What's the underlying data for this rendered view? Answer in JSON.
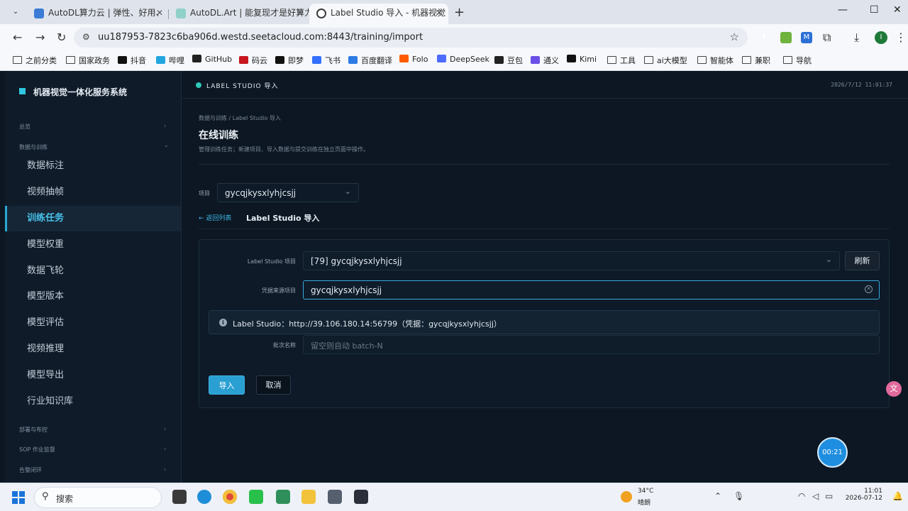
{
  "browser": {
    "tabs": [
      {
        "title": "AutoDL算力云 | 弹性、好用、",
        "favicon_color": "#3a7bd5"
      },
      {
        "title": "AutoDL.Art | 能复现才是好算力",
        "favicon_color": "#8fd0c8"
      },
      {
        "title": "Label Studio 导入 - 机器视觉",
        "favicon_color": "#3a3a3a"
      }
    ],
    "new_tab": "+",
    "url": "uu187953-7823c6ba906d.westd.seetacloud.com:8443/training/import",
    "profile_initial": "I",
    "extensions": [
      {
        "label": "⬇",
        "color": "#3b3b3b"
      },
      {
        "label": "●",
        "color": "#6fb33c"
      },
      {
        "label": "M",
        "color": "#2c6fd6"
      }
    ],
    "bookmarks": [
      {
        "label": "之前分类",
        "icon": "folder"
      },
      {
        "label": "国家政务",
        "icon": "folder"
      },
      {
        "label": "抖音",
        "icon": "#111111"
      },
      {
        "label": "哔哩",
        "icon": "#21a6e0"
      },
      {
        "label": "GitHub",
        "icon": "#222222"
      },
      {
        "label": "码云",
        "icon": "#c7161e"
      },
      {
        "label": "即梦",
        "icon": "#111111"
      },
      {
        "label": "飞书",
        "icon": "#3370ff"
      },
      {
        "label": "百度翻译",
        "icon": "#2d7be5"
      },
      {
        "label": "Folo",
        "icon": "#ff5c00"
      },
      {
        "label": "DeepSeek",
        "icon": "#4d6bfe"
      },
      {
        "label": "豆包",
        "icon": "#222222"
      },
      {
        "label": "通义",
        "icon": "#6a4ee8"
      },
      {
        "label": "Kimi",
        "icon": "#111111"
      },
      {
        "label": "工具",
        "icon": "folder"
      },
      {
        "label": "ai大模型",
        "icon": "folder"
      },
      {
        "label": "智能体",
        "icon": "folder"
      },
      {
        "label": "兼职",
        "icon": "folder"
      },
      {
        "label": "导航",
        "icon": "folder"
      }
    ]
  },
  "app": {
    "system_title": "机器视觉一体化服务系统",
    "header_title": "LABEL STUDIO 导入",
    "header_time": "2026/7/12 11:01:37",
    "sidebar": {
      "groups": [
        {
          "label": "总览",
          "chevron": "›"
        },
        {
          "label": "数据与训练",
          "chevron": "⌄"
        },
        {
          "label": "部署与布控",
          "chevron": "›"
        },
        {
          "label": "SOP 作业监督",
          "chevron": "›"
        },
        {
          "label": "告警闭环",
          "chevron": "›"
        }
      ],
      "items": [
        {
          "label": "数据标注"
        },
        {
          "label": "视频抽帧"
        },
        {
          "label": "训练任务"
        },
        {
          "label": "模型权重"
        },
        {
          "label": "数据飞轮"
        },
        {
          "label": "模型版本"
        },
        {
          "label": "模型评估"
        },
        {
          "label": "视频推理"
        },
        {
          "label": "模型导出"
        },
        {
          "label": "行业知识库"
        }
      ]
    },
    "breadcrumb": "数据与训练 / Label Studio 导入",
    "page_title": "在线训练",
    "page_desc": "管理训练任务；新建项目、导入数据与提交训练在独立页面中操作。",
    "project_label": "项目",
    "project_value": "gycqjkysxlyhjcsjj",
    "back_link": "← 返回列表",
    "sub_title": "Label Studio 导入",
    "form": {
      "ls_project_label": "Label Studio 项目",
      "ls_project_value": "[79] gycqjkysxlyhjcsjj",
      "refresh_label": "刷新",
      "source_label": "凭据来源项目",
      "source_value": "gycqjkysxlyhjcsjj",
      "info_text": "Label Studio：http://39.106.180.14:56799（凭据：gycqjkysxlyhjcsjj）",
      "batch_label": "批次名称",
      "batch_placeholder": "留空则自动 batch-N",
      "import_label": "导入",
      "cancel_label": "取消"
    },
    "translate_fab": "文",
    "timer": "00:21"
  },
  "taskbar": {
    "search_placeholder": "搜索",
    "temperature": "34°C",
    "condition": "晴朗",
    "time": "11:01",
    "date": "2026-07-12"
  }
}
